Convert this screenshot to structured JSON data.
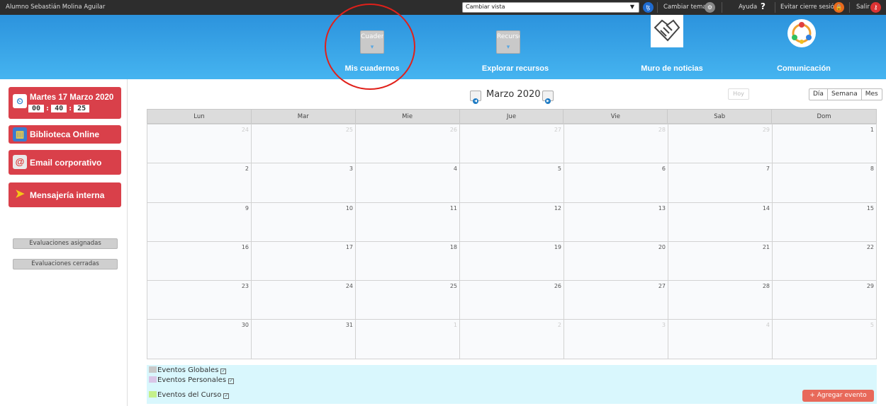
{
  "topbar": {
    "user_name": "Alumno Sebastián Molina Aguilar",
    "view_select": "Cambiar vista",
    "change_theme": "Cambiar tema",
    "help": "Ayuda",
    "help_glyph": "?",
    "avoid_logout": "Evitar cierre sesión",
    "exit": "Salir"
  },
  "nav": {
    "items": [
      {
        "label": "Mis cuadernos",
        "button_text": "Cuaderno"
      },
      {
        "label": "Explorar recursos",
        "button_text": "Recurso"
      },
      {
        "label": "Muro de noticias",
        "icon": "handshake-icon"
      },
      {
        "label": "Comunicación",
        "icon": "network-icon"
      }
    ]
  },
  "sidebar": {
    "date": "Martes 17 Marzo 2020",
    "clock": {
      "h": "00",
      "m": "40",
      "s": "25"
    },
    "buttons": [
      "Biblioteca Online",
      "Email corporativo",
      "Mensajería interna"
    ],
    "evaluations": [
      "Evaluaciones asignadas",
      "Evaluaciones cerradas"
    ]
  },
  "calendar": {
    "title": "Marzo 2020",
    "today": "Hoy",
    "views": [
      "Día",
      "Semana",
      "Mes"
    ],
    "weekdays": [
      "Lun",
      "Mar",
      "Mie",
      "Jue",
      "Vie",
      "Sab",
      "Dom"
    ],
    "weeks": [
      [
        {
          "d": "24",
          "o": true
        },
        {
          "d": "25",
          "o": true
        },
        {
          "d": "26",
          "o": true
        },
        {
          "d": "27",
          "o": true
        },
        {
          "d": "28",
          "o": true
        },
        {
          "d": "29",
          "o": true
        },
        {
          "d": "1",
          "o": false
        }
      ],
      [
        {
          "d": "2",
          "o": false
        },
        {
          "d": "3",
          "o": false
        },
        {
          "d": "4",
          "o": false
        },
        {
          "d": "5",
          "o": false
        },
        {
          "d": "6",
          "o": false
        },
        {
          "d": "7",
          "o": false
        },
        {
          "d": "8",
          "o": false
        }
      ],
      [
        {
          "d": "9",
          "o": false
        },
        {
          "d": "10",
          "o": false
        },
        {
          "d": "11",
          "o": false
        },
        {
          "d": "12",
          "o": false
        },
        {
          "d": "13",
          "o": false
        },
        {
          "d": "14",
          "o": false
        },
        {
          "d": "15",
          "o": false
        }
      ],
      [
        {
          "d": "16",
          "o": false
        },
        {
          "d": "17",
          "o": false
        },
        {
          "d": "18",
          "o": false
        },
        {
          "d": "19",
          "o": false
        },
        {
          "d": "20",
          "o": false
        },
        {
          "d": "21",
          "o": false
        },
        {
          "d": "22",
          "o": false
        }
      ],
      [
        {
          "d": "23",
          "o": false
        },
        {
          "d": "24",
          "o": false
        },
        {
          "d": "25",
          "o": false
        },
        {
          "d": "26",
          "o": false
        },
        {
          "d": "27",
          "o": false
        },
        {
          "d": "28",
          "o": false
        },
        {
          "d": "29",
          "o": false
        }
      ],
      [
        {
          "d": "30",
          "o": false
        },
        {
          "d": "31",
          "o": false
        },
        {
          "d": "1",
          "o": true
        },
        {
          "d": "2",
          "o": true
        },
        {
          "d": "3",
          "o": true
        },
        {
          "d": "4",
          "o": true
        },
        {
          "d": "5",
          "o": true
        }
      ]
    ]
  },
  "legend": {
    "items": [
      {
        "label": "Eventos Globales",
        "color": "#c8c8c8"
      },
      {
        "label": "Eventos Personales",
        "color": "#d9c6e8"
      },
      {
        "label": "Eventos del Curso",
        "color": "#c4f08a"
      }
    ],
    "add_event": "+ Agregar evento"
  },
  "colors": {
    "nav_blue": "#2c93dd",
    "sidebar_red": "#d9404a",
    "legend_bg": "#d9f7fd",
    "annotation_red": "#e0201a"
  }
}
